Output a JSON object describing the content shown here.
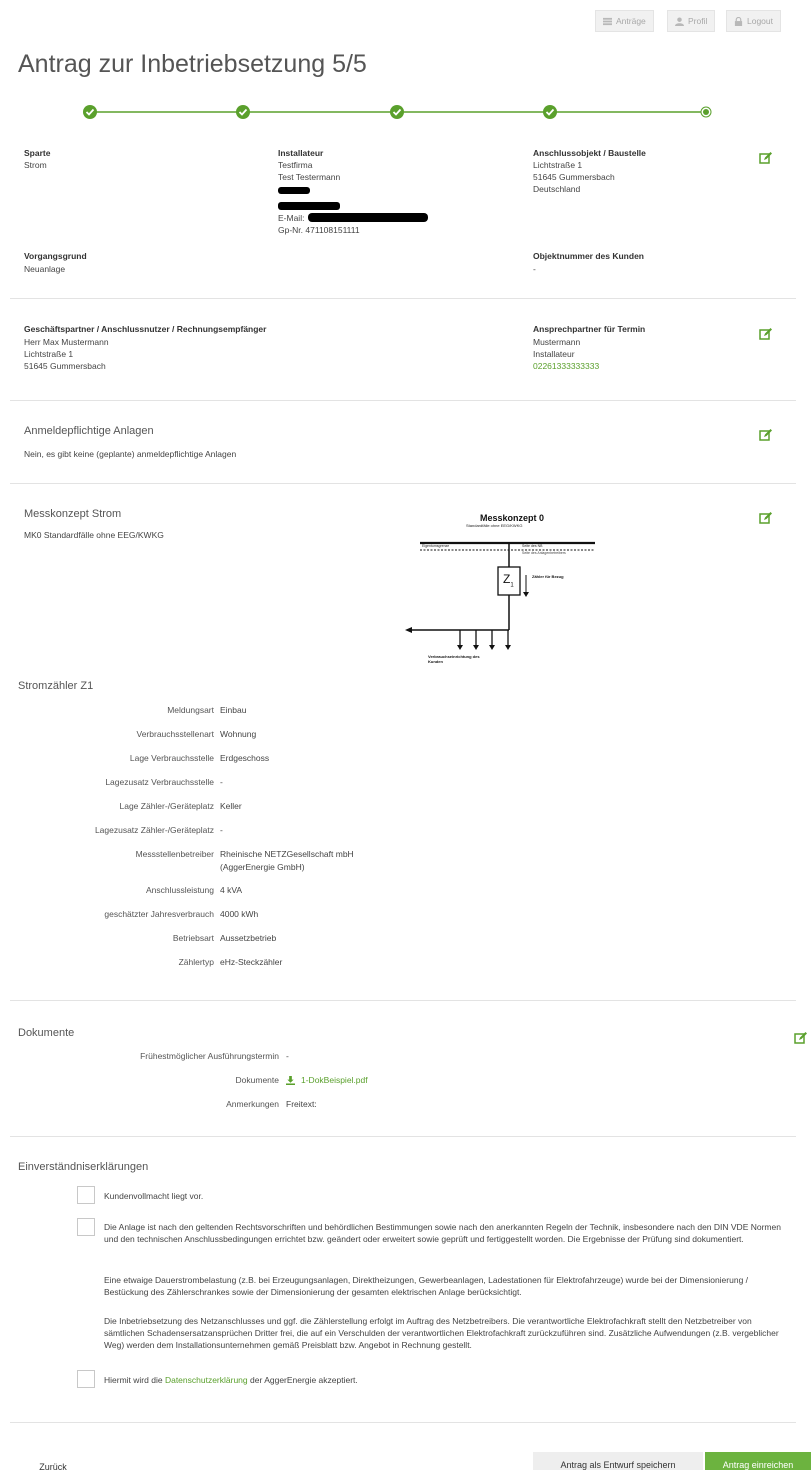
{
  "header": {
    "antraege_label": "Anträge",
    "profil_label": "Profil",
    "logout_label": "Logout",
    "title": "Antrag zur Inbetriebsetzung 5/5"
  },
  "overview": {
    "sparte_label": "Sparte",
    "sparte_value": "Strom",
    "installateur_label": "Installateur",
    "installateur_lines": [
      "Testfirma",
      "Test Testermann"
    ],
    "email_label": "E-Mail:",
    "gpnr": "Gp-Nr. 47110815111​1",
    "anschluss_label": "Anschlussobjekt / Baustelle",
    "anschluss_lines": [
      "Lichtstraße 1",
      "51645 Gummersbach",
      "Deutschland"
    ],
    "vorgang_label": "Vorgangsgrund",
    "vorgang_value": "Neuanlage",
    "objektnr_label": "Objektnummer des Kunden",
    "objektnr_value": "-"
  },
  "partner": {
    "gp_label": "Geschäftspartner / Anschlussnutzer / Rechnungsempfänger",
    "gp_lines": [
      "Herr Max Mustermann",
      "Lichtstraße 1",
      "51645 Gummersbach"
    ],
    "ap_label": "Ansprechpartner für Termin",
    "ap_lines": [
      "Mustermann",
      "Installateur"
    ],
    "ap_phone": "02261333333333"
  },
  "anlagen": {
    "title": "Anmeldepflichtige Anlagen",
    "text": "Nein, es gibt keine (geplante) anmeldepflichtige Anlagen"
  },
  "messkonzept": {
    "title": "Messkonzept Strom",
    "text": "MK0 Standardfälle ohne EEG/KWKG",
    "diagram_title": "Messkonzept 0",
    "diagram_subtitle": "Standardfälle ohne EEG/KWKG",
    "eigentumsgrenze": "Eigentumsgrenze",
    "seite_nb": "Seite des NB",
    "seite_kunde": "Seite des Anlagenbetreibers",
    "meter_label": "Z",
    "meter_sub": "1",
    "zaehler_bezug": "Zähler für Bezug",
    "verbrauch": "Verbrauchseinrichtung des Kunden"
  },
  "zaehler": {
    "title": "Stromzähler Z1",
    "rows": [
      {
        "label": "Meldungsart",
        "value": "Einbau"
      },
      {
        "label": "Verbrauchsstellenart",
        "value": "Wohnung"
      },
      {
        "label": "Lage Verbrauchsstelle",
        "value": "Erdgeschoss"
      },
      {
        "label": "Lagezusatz Verbrauchsstelle",
        "value": "-"
      },
      {
        "label": "Lage Zähler-/Geräteplatz",
        "value": "Keller"
      },
      {
        "label": "Lagezusatz Zähler-/Geräteplatz",
        "value": "-"
      },
      {
        "label": "Messstellenbetreiber",
        "value": "Rheinische NETZGesellschaft mbH",
        "value2": "(AggerEnergie GmbH)"
      },
      {
        "label": "Anschlussleistung",
        "value": "4 kVA"
      },
      {
        "label": "geschätzter Jahresverbrauch",
        "value": "4000 kWh"
      },
      {
        "label": "Betriebsart",
        "value": "Aussetzbetrieb"
      },
      {
        "label": "Zählertyp",
        "value": "eHz-Steckzähler"
      }
    ]
  },
  "dokumente": {
    "title": "Dokumente",
    "termin_label": "Frühestmöglicher Ausführungstermin",
    "termin_value": "-",
    "dok_label": "Dokumente",
    "dok_file": "1-DokBeispiel.pdf",
    "anm_label": "Anmerkungen",
    "anm_value": "Freitext:"
  },
  "consent": {
    "title": "Einverständniserklärungen",
    "item1": "Kundenvollmacht liegt vor.",
    "item2_p1": "Die Anlage ist nach den geltenden Rechtsvorschriften und behördlichen Bestimmungen sowie nach den anerkannten Regeln der Technik, insbesondere nach den DIN VDE Normen und den technischen Anschlussbedingungen errichtet bzw. geändert oder erweitert sowie geprüft und fertiggestellt worden. Die Ergebnisse der Prüfung sind dokumentiert.",
    "item2_p2": "Eine etwaige Dauerstrombelastung (z.B. bei Erzeugungsanlagen, Direktheizungen, Gewerbeanlagen, Ladestationen für Elektrofahrzeuge) wurde bei der Dimensionierung / Bestückung des Zählerschrankes sowie der Dimensionierung der gesamten elektrischen Anlage berücksichtigt.",
    "item2_p3": "Die Inbetriebsetzung des Netzanschlusses und ggf. die Zählerstellung erfolgt im Auftrag des Netzbetreibers. Die verantwortliche Elektrofachkraft stellt den Netzbetreiber von sämtlichen Schadensersatzansprüchen Dritter frei, die auf ein Verschulden der verantwortlichen Elektrofachkraft zurückzuführen sind. Zusätzliche Aufwendungen (z.B. vergeblicher Weg) werden dem Installationsunternehmen gemäß Preisblatt bzw. Angebot in Rechnung gestellt.",
    "item3_pre": "Hiermit wird die",
    "item3_link": "Datenschutzerklärung",
    "item3_post": "der AggerEnergie akzeptiert."
  },
  "footer": {
    "back_label": "Zurück",
    "draft_label": "Antrag als Entwurf speichern",
    "submit_label": "Antrag einreichen"
  },
  "colors": {
    "accent": "#5aa02c",
    "accent_button": "#6cb33f"
  }
}
